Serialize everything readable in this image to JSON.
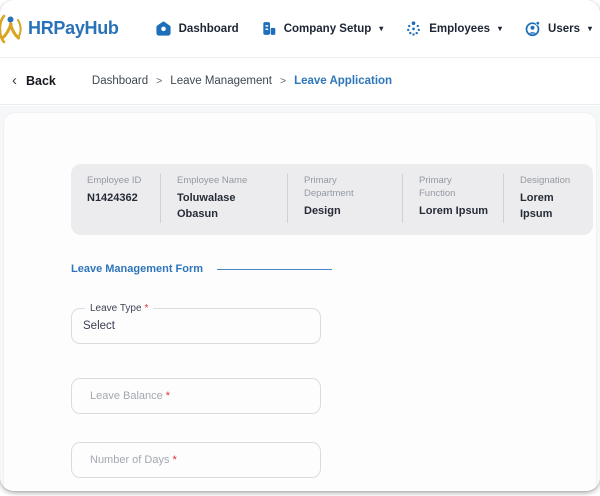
{
  "colors": {
    "accent_blue": "#2a72b8",
    "icon_blue": "#1e6fba",
    "brand_gold": "#d9a520",
    "required_red": "#e03131"
  },
  "brand": {
    "name": "HRPayHub"
  },
  "navbar": {
    "caret": "▾",
    "items": [
      {
        "label": "Dashboard",
        "icon": "home-icon",
        "dropdown": false
      },
      {
        "label": "Company Setup",
        "icon": "building-icon",
        "dropdown": true
      },
      {
        "label": "Employees",
        "icon": "team-dots-icon",
        "dropdown": true
      },
      {
        "label": "Users",
        "icon": "user-circle-badge-icon",
        "dropdown": true
      }
    ]
  },
  "breadcrumb": {
    "back_chevron": "‹",
    "back_label": "Back",
    "separator": ">",
    "items": [
      "Dashboard",
      "Leave Management",
      "Leave Application"
    ]
  },
  "employee_summary": {
    "columns": [
      {
        "label": "Employee ID",
        "value": "N1424362"
      },
      {
        "label": "Employee Name",
        "value": "Toluwalase Obasun"
      },
      {
        "label": "Primary Department",
        "value": "Design"
      },
      {
        "label": "Primary Function",
        "value": "Lorem Ipsum"
      },
      {
        "label": "Designation",
        "value": "Lorem Ipsum"
      }
    ]
  },
  "form": {
    "title": "Leave Management Form",
    "required_marker": "*",
    "leave_type": {
      "label": "Leave Type",
      "value": "Select"
    },
    "leave_balance": {
      "placeholder": "Leave Balance"
    },
    "number_of_days": {
      "placeholder": "Number of Days"
    }
  }
}
